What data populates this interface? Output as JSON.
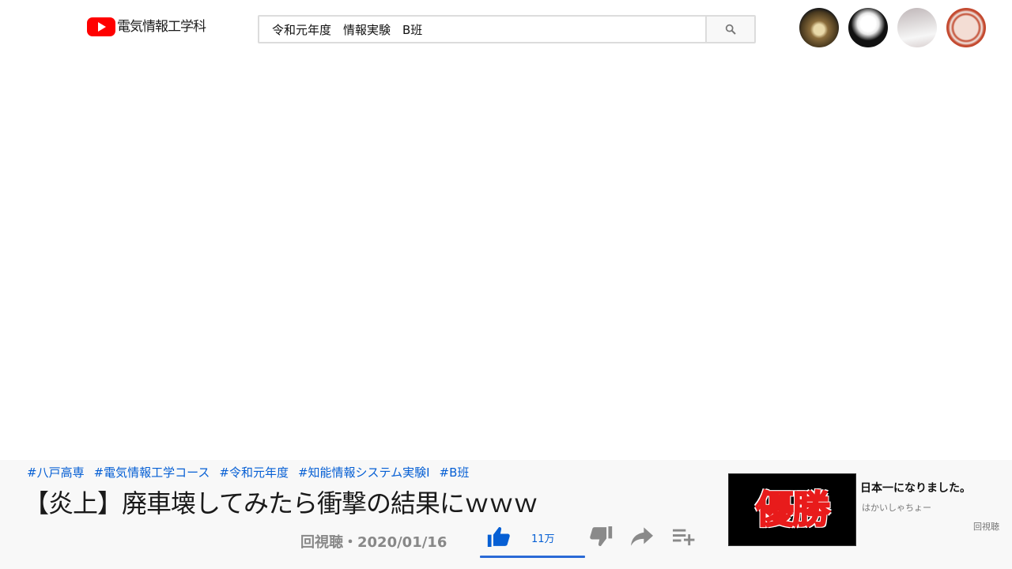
{
  "header": {
    "logo_text": "電気情報工学科",
    "search": {
      "value": "令和元年度　情報実験　B班",
      "placeholder": ""
    },
    "avatars": [
      "avatar-1",
      "avatar-2",
      "avatar-3",
      "avatar-4"
    ]
  },
  "video": {
    "tags": [
      "#八戸高専",
      "#電気情報工学コース",
      "#令和元年度",
      "#知能情報システム実験Ⅰ",
      "#B班"
    ],
    "title": "【炎上】廃車壊してみたら衝撃の結果にｗｗｗ",
    "meta": "回視聴・2020/01/16",
    "like_count": "11万",
    "like_ratio": 1.0
  },
  "recommendation": {
    "thumb_text": "優勝",
    "title": "日本一になりました。",
    "channel": "はかいしゃちょー",
    "views": "回視聴"
  },
  "colors": {
    "accent": "#065fd4",
    "like_bar": "#2a6ad6",
    "youtube_red": "#ff0000",
    "bar_bg": "#f8f8f8"
  },
  "icons": {
    "logo": "youtube-play-icon",
    "search": "search-icon",
    "like": "thumb-up-icon",
    "dislike": "thumb-down-icon",
    "share": "share-icon",
    "add_to_playlist": "playlist-add-icon"
  }
}
